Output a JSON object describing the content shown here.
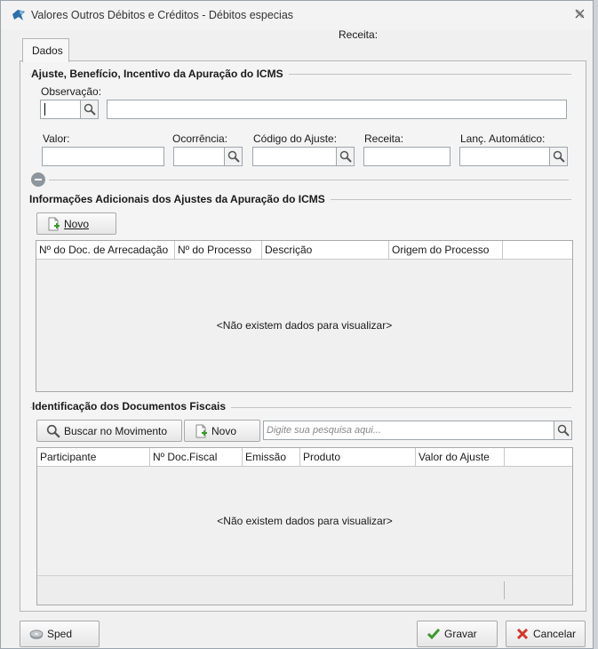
{
  "window": {
    "title": "Valores Outros Débitos e Créditos - Débitos especias",
    "top_receita_label": "Receita:"
  },
  "tabs": [
    {
      "label": "Dados"
    }
  ],
  "ajuste": {
    "title": "Ajuste, Benefício, Incentivo da Apuração do ICMS",
    "observacao_label": "Observação:",
    "valor_label": "Valor:",
    "ocorrencia_label": "Ocorrência:",
    "codigo_ajuste_label": "Código do Ajuste:",
    "receita_label": "Receita:",
    "lanc_automatico_label": "Lanç. Automático:"
  },
  "info_adicionais": {
    "title": "Informações Adicionais dos Ajustes da Apuração do ICMS",
    "novo_button": "Novo",
    "columns": [
      "Nº do Doc. de Arrecadação",
      "Nº do Processo",
      "Descrição",
      "Origem do Processo"
    ],
    "empty_message": "<Não existem dados para visualizar>"
  },
  "documentos": {
    "title": "Identificação dos Documentos Fiscais",
    "buscar_button": "Buscar no Movimento",
    "novo_button": "Novo",
    "search_placeholder": "Digite sua pesquisa aqui...",
    "columns": [
      "Participante",
      "Nº Doc.Fiscal",
      "Emissão",
      "Produto",
      "Valor do Ajuste"
    ],
    "empty_message": "<Não existem dados para visualizar>"
  },
  "footer": {
    "sped_button": "Sped",
    "gravar_button": "Gravar",
    "cancelar_button": "Cancelar"
  },
  "colors": {
    "window_bg": "#f0f0f0",
    "border": "#a9a9a9",
    "ok_green": "#3a9a2a",
    "cancel_red": "#d2362b"
  }
}
